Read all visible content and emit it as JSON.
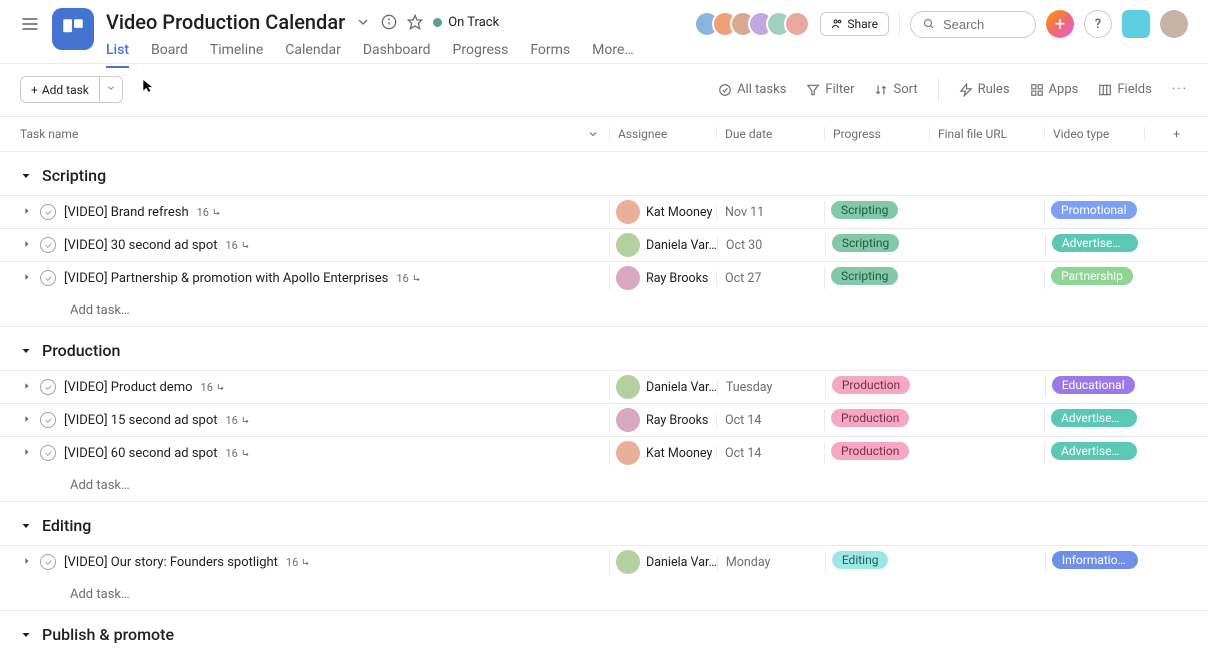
{
  "header": {
    "project_title": "Video Production Calendar",
    "status_label": "On Track",
    "share_label": "Share",
    "search_placeholder": "Search"
  },
  "tabs": [
    {
      "label": "List",
      "active": true
    },
    {
      "label": "Board"
    },
    {
      "label": "Timeline"
    },
    {
      "label": "Calendar"
    },
    {
      "label": "Dashboard"
    },
    {
      "label": "Progress"
    },
    {
      "label": "Forms"
    },
    {
      "label": "More…"
    }
  ],
  "toolbar": {
    "add_task": "Add task",
    "all_tasks": "All tasks",
    "filter": "Filter",
    "sort": "Sort",
    "rules": "Rules",
    "apps": "Apps",
    "fields": "Fields"
  },
  "columns": {
    "task_name": "Task name",
    "assignee": "Assignee",
    "due_date": "Due date",
    "progress": "Progress",
    "final_url": "Final file URL",
    "video_type": "Video type"
  },
  "add_task_placeholder": "Add task…",
  "sections": [
    {
      "name": "Scripting",
      "tasks": [
        {
          "title": "[VIDEO] Brand refresh",
          "subtasks": "16",
          "assignee": "Kat Mooney",
          "av": "av1",
          "due": "Nov 11",
          "progress": "Scripting",
          "progress_class": "p-scripting",
          "type": "Promotional",
          "type_class": "p-promotional"
        },
        {
          "title": "[VIDEO] 30 second ad spot",
          "subtasks": "16",
          "assignee": "Daniela Var…",
          "av": "av2",
          "due": "Oct 30",
          "progress": "Scripting",
          "progress_class": "p-scripting",
          "type": "Advertisem…",
          "type_class": "p-advertisement"
        },
        {
          "title": "[VIDEO] Partnership & promotion with Apollo Enterprises",
          "subtasks": "16",
          "assignee": "Ray Brooks",
          "av": "av3",
          "due": "Oct 27",
          "progress": "Scripting",
          "progress_class": "p-scripting",
          "type": "Partnership",
          "type_class": "p-partnership"
        }
      ]
    },
    {
      "name": "Production",
      "tasks": [
        {
          "title": "[VIDEO] Product demo",
          "subtasks": "16",
          "assignee": "Daniela Var…",
          "av": "av2",
          "due": "Tuesday",
          "progress": "Production",
          "progress_class": "p-production",
          "type": "Educational",
          "type_class": "p-educational"
        },
        {
          "title": "[VIDEO] 15 second ad spot",
          "subtasks": "16",
          "assignee": "Ray Brooks",
          "av": "av3",
          "due": "Oct 14",
          "progress": "Production",
          "progress_class": "p-production",
          "type": "Advertisem…",
          "type_class": "p-advertisement"
        },
        {
          "title": "[VIDEO] 60 second ad spot",
          "subtasks": "16",
          "assignee": "Kat Mooney",
          "av": "av1",
          "due": "Oct 14",
          "progress": "Production",
          "progress_class": "p-production",
          "type": "Advertisem…",
          "type_class": "p-advertisement"
        }
      ]
    },
    {
      "name": "Editing",
      "tasks": [
        {
          "title": "[VIDEO] Our story: Founders spotlight",
          "subtasks": "16",
          "assignee": "Daniela Var…",
          "av": "av2",
          "due": "Monday",
          "progress": "Editing",
          "progress_class": "p-editing",
          "type": "Informational",
          "type_class": "p-informational"
        }
      ]
    },
    {
      "name": "Publish & promote",
      "tasks": []
    }
  ]
}
